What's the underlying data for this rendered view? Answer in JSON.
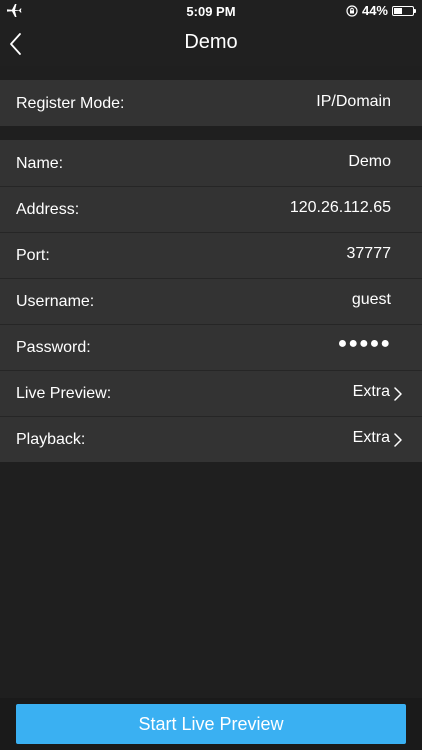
{
  "status_bar": {
    "time": "5:09 PM",
    "battery_text": "44%",
    "battery_level": 0.44
  },
  "nav": {
    "title": "Demo"
  },
  "register": {
    "label": "Register Mode:",
    "value": "IP/Domain"
  },
  "device_fields": [
    {
      "label": "Name:",
      "value": "Demo"
    },
    {
      "label": "Address:",
      "value": "120.26.112.65"
    },
    {
      "label": "Port:",
      "value": "37777"
    },
    {
      "label": "Username:",
      "value": "guest"
    },
    {
      "label": "Password:",
      "value": "●●●●●"
    },
    {
      "label": "Live Preview:",
      "value": "Extra"
    },
    {
      "label": "Playback:",
      "value": "Extra"
    }
  ],
  "action": {
    "start_label": "Start Live Preview"
  },
  "colors": {
    "background": "#1f1f1f",
    "row_background": "#333333",
    "accent": "#3ab0f2",
    "text": "#ffffff"
  },
  "icons": {
    "airplane": "airplane-icon",
    "rotation_lock": "rotation-lock-icon",
    "battery": "battery-icon",
    "back": "back-chevron-icon",
    "row_chevron": "chevron-right-icon"
  }
}
